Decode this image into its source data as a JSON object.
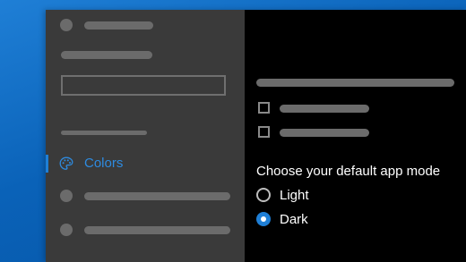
{
  "sidebar": {
    "selected_item": {
      "label": "Colors",
      "icon": "palette-icon"
    }
  },
  "content": {
    "app_mode": {
      "heading": "Choose your default app mode",
      "options": [
        {
          "label": "Light",
          "selected": false
        },
        {
          "label": "Dark",
          "selected": true
        }
      ]
    }
  },
  "colors": {
    "accent": "#1f7fd6",
    "sidebar_bg": "#3a3a3a",
    "content_bg": "#000000",
    "placeholder": "#6b6b6b"
  }
}
